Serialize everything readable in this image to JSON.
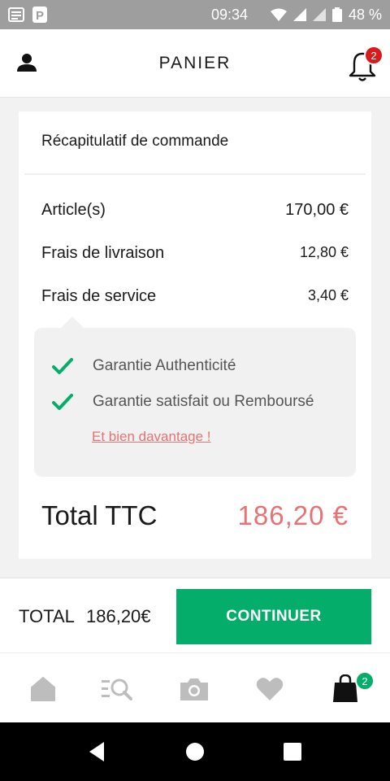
{
  "status_bar": {
    "time": "09:34",
    "battery": "48 %",
    "left_icons": [
      "news-icon",
      "parking-p-icon"
    ],
    "right_icons": [
      "wifi-icon",
      "signal-icon",
      "signal-icon",
      "battery-icon"
    ]
  },
  "header": {
    "title": "PANIER",
    "notification_count": "2"
  },
  "summary": {
    "title": "Récapitulatif de commande",
    "rows": [
      {
        "label": "Article(s)",
        "value": "170,00 €"
      },
      {
        "label": "Frais de livraison",
        "value": "12,80 €"
      },
      {
        "label": "Frais de service",
        "value": "3,40 €"
      }
    ],
    "guarantees": [
      {
        "text": "Garantie Authenticité"
      },
      {
        "text": "Garantie satisfait ou Remboursé"
      }
    ],
    "more_link": "Et bien davantage !",
    "total_label": "Total TTC",
    "total_value": "186,20 €"
  },
  "checkout_bar": {
    "total_label": "TOTAL",
    "total_value": "186,20€",
    "button_label": "CONTINUER"
  },
  "tab_bar": {
    "cart_count": "2",
    "tabs": [
      "home-icon",
      "search-list-icon",
      "camera-icon",
      "heart-icon",
      "cart-bag-icon"
    ]
  },
  "colors": {
    "accent_green": "#05ad6a",
    "price_red": "#e57373",
    "badge_red": "#d81c1c",
    "status_bar_gray": "#9e9e9e"
  }
}
